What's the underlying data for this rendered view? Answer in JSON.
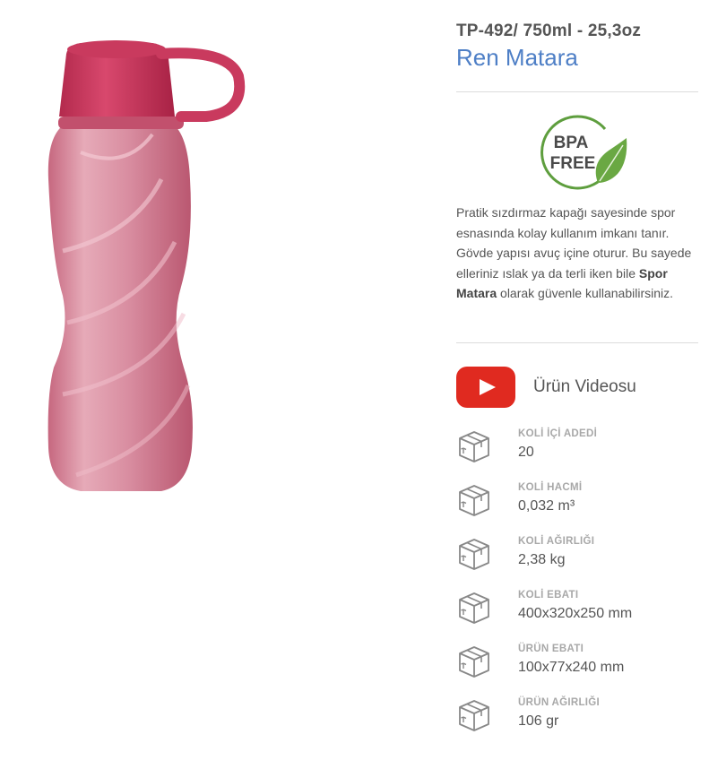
{
  "product": {
    "code": "TP-492/ 750ml - 25,3oz",
    "name": "Ren Matara"
  },
  "badge": {
    "line1": "BPA",
    "line2": "FREE",
    "color": "#5e9e3e"
  },
  "description": {
    "part1": "Pratik sızdırmaz kapağı sayesinde spor esnasında kolay kullanım imkanı tanır. Gövde yapısı avuç içine oturur. Bu sayede elleriniz ıslak ya da terli iken bile ",
    "bold": "Spor Matara",
    "part2": " olarak güvenle kullanabilirsiniz."
  },
  "video": {
    "label": "Ürün Videosu",
    "icon": "youtube-play-icon",
    "color": "#e02a20"
  },
  "specs": [
    {
      "label": "KOLİ İÇİ ADEDİ",
      "value": "20",
      "icon": "box-icon"
    },
    {
      "label": "KOLİ HACMİ",
      "value": "0,032 m³",
      "icon": "box-icon"
    },
    {
      "label": "KOLİ AĞIRLIĞI",
      "value": "2,38 kg",
      "icon": "box-icon"
    },
    {
      "label": "KOLİ EBATI",
      "value": "400x320x250 mm",
      "icon": "box-icon"
    },
    {
      "label": "ÜRÜN EBATI",
      "value": "100x77x240 mm",
      "icon": "box-icon"
    },
    {
      "label": "ÜRÜN AĞIRLIĞI",
      "value": "106 gr",
      "icon": "box-icon"
    }
  ],
  "colors": {
    "title": "#4e7fc6",
    "bottle": "#d9899c",
    "cap": "#c93a5e"
  }
}
